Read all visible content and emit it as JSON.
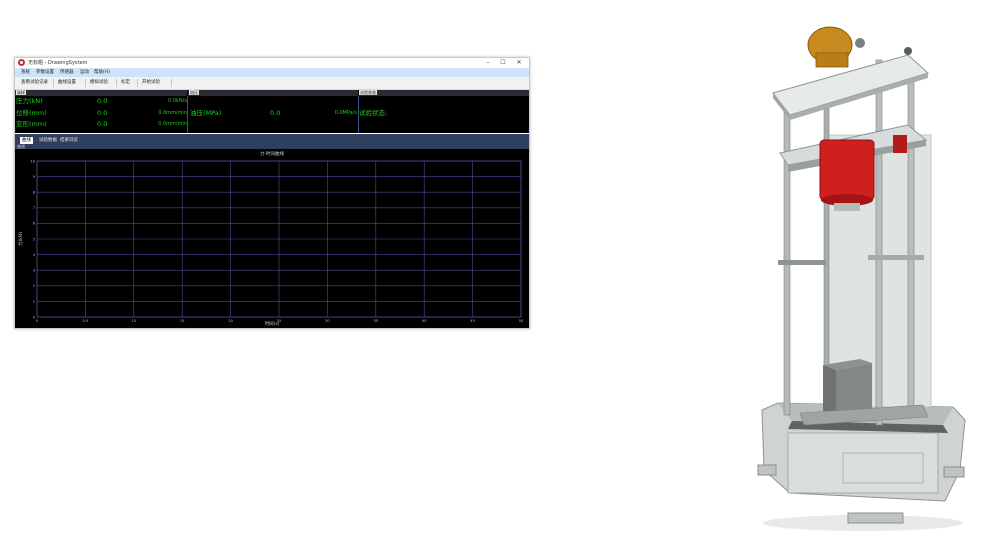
{
  "window": {
    "title": "无标题 - DrawingSystem",
    "min_glyph": "–",
    "max_glyph": "☐",
    "close_glyph": "✕"
  },
  "menu": [
    "系统",
    "参数设置",
    "传感器",
    "运动",
    "帮助(H)"
  ],
  "toolbar": [
    "查看试验记录",
    "曲线设置",
    "模拟试验",
    "标定",
    "开始试验"
  ],
  "panel": {
    "group_left": "采样",
    "group_mid": "加压",
    "group_right": "试验状态",
    "rows": [
      {
        "label": "压力(kN)",
        "value": "0.0",
        "rate": "0.0kN/s"
      },
      {
        "label": "位移(mm)",
        "value": "0.0",
        "rate": "0.0mm/min"
      },
      {
        "label": "变形(mm)",
        "value": "0.0",
        "rate": "0.0mm/min"
      }
    ],
    "pressure": {
      "label": "油压(MPa)",
      "value": "0.0",
      "rate": "0.0MPa/s"
    },
    "status_label": "试验状态:"
  },
  "tabs": {
    "items": [
      "曲线",
      "试验数据",
      "结果浏览"
    ],
    "active_index": 0,
    "sub_label": "曲线"
  },
  "chart_data": {
    "type": "line",
    "title": "力-时间曲线",
    "xlabel": "时间(s)",
    "ylabel": "力(kN)",
    "xlim": [
      0,
      50
    ],
    "ylim": [
      0,
      10
    ],
    "x_ticks": [
      "0",
      "5.0",
      "10",
      "15",
      "20",
      "25",
      "30",
      "35",
      "40",
      "45",
      "50"
    ],
    "y_ticks": [
      "0",
      "1",
      "2",
      "3",
      "4",
      "5",
      "6",
      "7",
      "8",
      "9",
      "10"
    ],
    "grid": true,
    "series": []
  },
  "colors": {
    "readout_text": "#19d119",
    "grid": "#4a4f9a",
    "menu_bar": "#cde3f7",
    "tab_bar": "#2e3e5c"
  }
}
